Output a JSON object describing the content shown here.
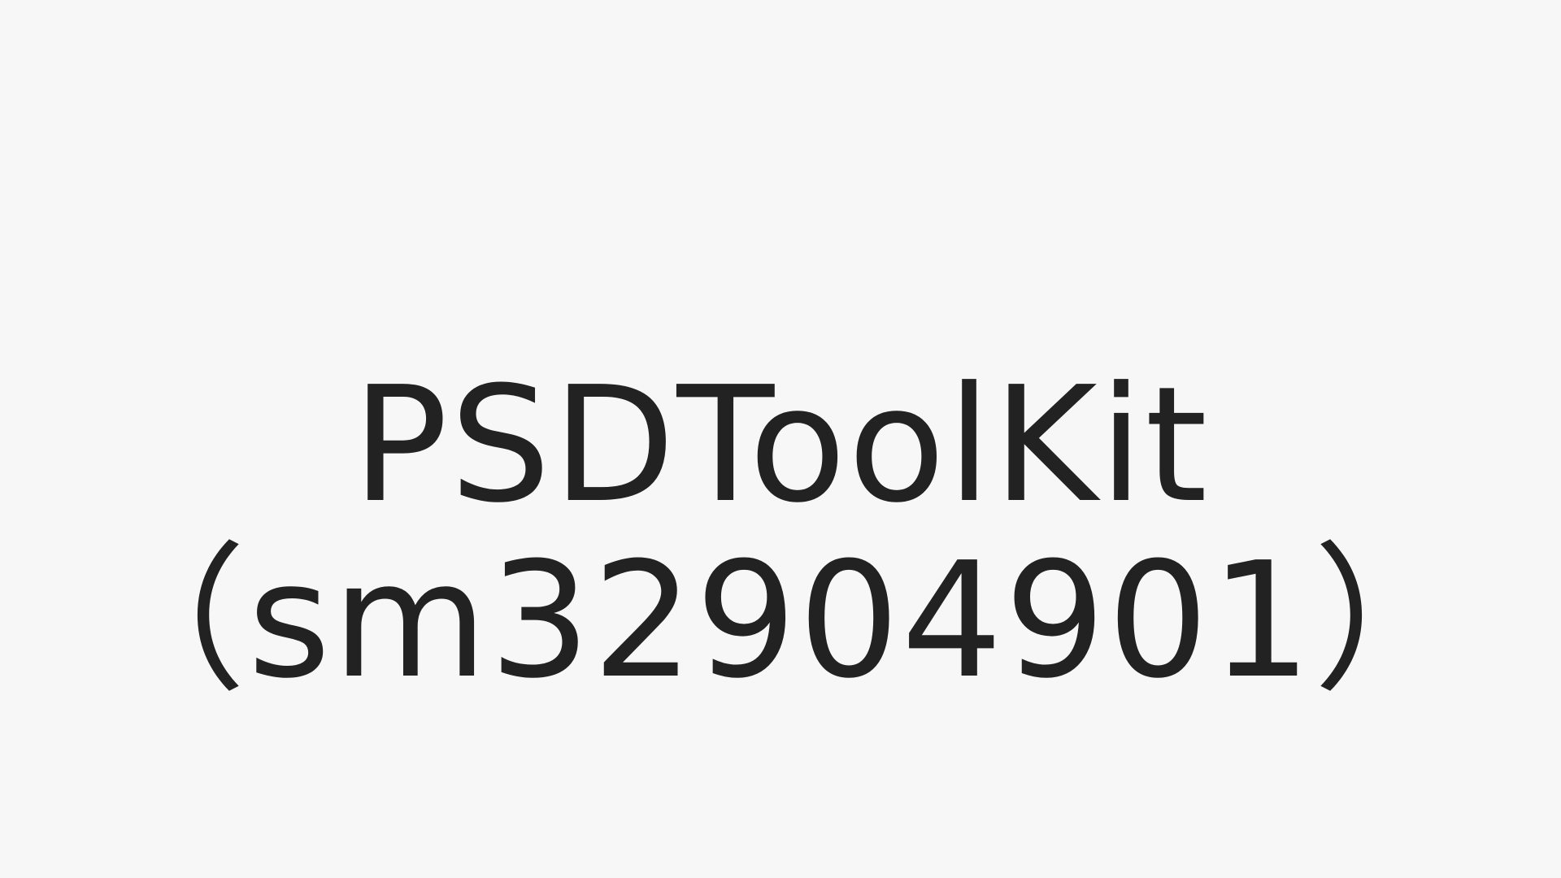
{
  "title": {
    "line1": "PSDToolKit",
    "line2": "（sm32904901）"
  },
  "colors": {
    "background": "#f7f7f7",
    "text": "#222222"
  }
}
